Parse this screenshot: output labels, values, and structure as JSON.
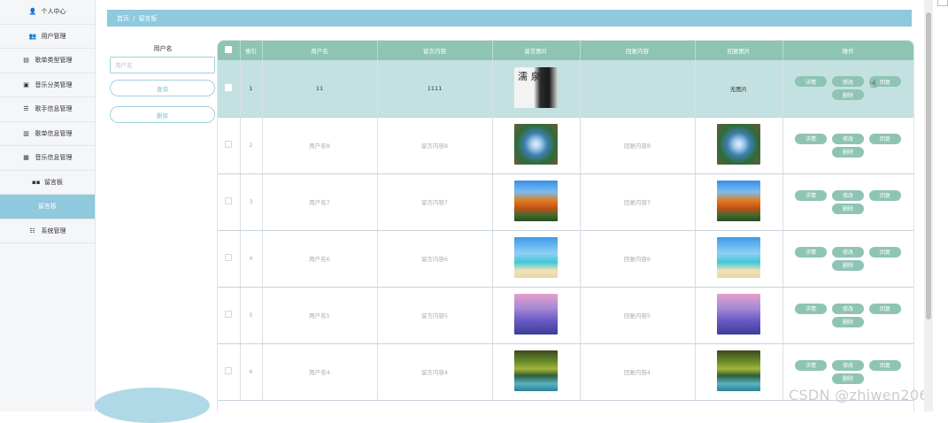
{
  "sidebar": {
    "items": [
      {
        "label": "个人中心",
        "icon": "user-icon",
        "glyph": "👤",
        "style": "normal"
      },
      {
        "label": "用户管理",
        "icon": "users-icon",
        "glyph": "👥",
        "style": "normal"
      },
      {
        "label": "歌单类型管理",
        "icon": "list-icon",
        "glyph": "▤",
        "style": "normal"
      },
      {
        "label": "音乐分类管理",
        "icon": "music-icon",
        "glyph": "▣",
        "style": "normal"
      },
      {
        "label": "歌手信息管理",
        "icon": "singer-icon",
        "glyph": "☰",
        "style": "normal"
      },
      {
        "label": "歌单信息管理",
        "icon": "playlist-icon",
        "glyph": "▥",
        "style": "normal"
      },
      {
        "label": "音乐信息管理",
        "icon": "song-icon",
        "glyph": "▦",
        "style": "normal"
      },
      {
        "label": "留言板",
        "icon": "grid-icon",
        "glyph": "▪▪",
        "style": "sub"
      },
      {
        "label": "留言板",
        "icon": "",
        "glyph": "",
        "style": "active"
      },
      {
        "label": "系统管理",
        "icon": "settings-icon",
        "glyph": "☷",
        "style": "normal"
      }
    ]
  },
  "breadcrumb": {
    "home": "首页",
    "separator": "/",
    "current": "留言板"
  },
  "search": {
    "label": "用户名",
    "placeholder": "用户名",
    "value": "",
    "query_button": "查询",
    "delete_button": "删除"
  },
  "table": {
    "columns": [
      "",
      "索引",
      "用户名",
      "留言内容",
      "留言图片",
      "回复内容",
      "回复图片",
      "操作"
    ],
    "rows": [
      {
        "index": "1",
        "username": "11",
        "content": "1111",
        "image": "poster",
        "image_text": "濡\n泉",
        "reply": "",
        "reply_image": "",
        "reply_image_text": "无图片",
        "highlighted": true
      },
      {
        "index": "2",
        "username": "用户名8",
        "content": "留言内容8",
        "image": "forest",
        "image_text": "",
        "reply": "回复内容8",
        "reply_image": "forest",
        "reply_image_text": "",
        "highlighted": false
      },
      {
        "index": "3",
        "username": "用户名7",
        "content": "留言内容7",
        "image": "autumn",
        "image_text": "",
        "reply": "回复内容7",
        "reply_image": "autumn",
        "reply_image_text": "",
        "highlighted": false
      },
      {
        "index": "4",
        "username": "用户名6",
        "content": "留言内容6",
        "image": "beach",
        "image_text": "",
        "reply": "回复内容6",
        "reply_image": "beach",
        "reply_image_text": "",
        "highlighted": false
      },
      {
        "index": "5",
        "username": "用户名5",
        "content": "留言内容5",
        "image": "purple",
        "image_text": "",
        "reply": "回复内容5",
        "reply_image": "purple",
        "reply_image_text": "",
        "highlighted": false
      },
      {
        "index": "6",
        "username": "用户名4",
        "content": "留言内容4",
        "image": "falls",
        "image_text": "",
        "reply": "回复内容4",
        "reply_image": "falls",
        "reply_image_text": "",
        "highlighted": false
      }
    ],
    "actions": {
      "detail": "详情",
      "edit": "修改",
      "reply": "回复",
      "delete": "删除"
    }
  },
  "watermark": "CSDN @zhiwen206",
  "colors": {
    "accent": "#8ec9dd",
    "header": "#8fc4b5",
    "highlight_row": "#c4e1e1"
  }
}
